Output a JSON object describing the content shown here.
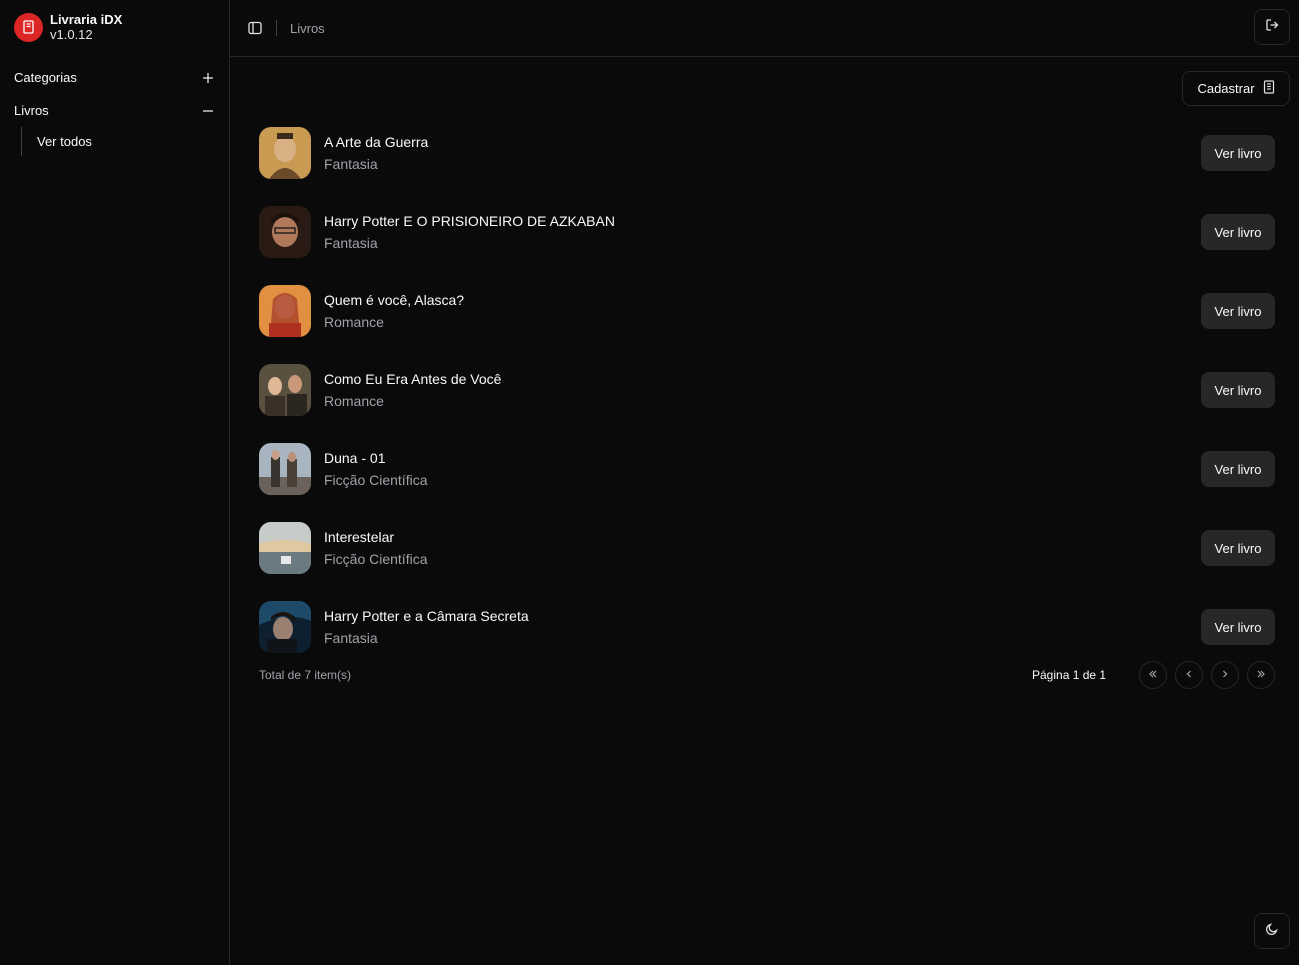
{
  "brand": {
    "name": "Livraria iDX",
    "version": "v1.0.12"
  },
  "sidebar": {
    "groups": [
      {
        "label": "Categorias",
        "state": "collapsed"
      },
      {
        "label": "Livros",
        "state": "expanded",
        "children": [
          {
            "label": "Ver todos"
          }
        ]
      }
    ]
  },
  "header": {
    "breadcrumb": "Livros"
  },
  "actions": {
    "cadastrar_label": "Cadastrar"
  },
  "books": [
    {
      "title": "A Arte da Guerra",
      "category": "Fantasia",
      "button": "Ver livro"
    },
    {
      "title": "Harry Potter E O PRISIONEIRO DE AZKABAN",
      "category": "Fantasia",
      "button": "Ver livro"
    },
    {
      "title": "Quem é você, Alasca?",
      "category": "Romance",
      "button": "Ver livro"
    },
    {
      "title": "Como Eu Era Antes de Você",
      "category": "Romance",
      "button": "Ver livro"
    },
    {
      "title": "Duna - 01",
      "category": "Ficção Científica",
      "button": "Ver livro"
    },
    {
      "title": "Interestelar",
      "category": "Ficção Científica",
      "button": "Ver livro"
    },
    {
      "title": "Harry Potter e a Câmara Secreta",
      "category": "Fantasia",
      "button": "Ver livro"
    }
  ],
  "pagination": {
    "total": "Total de 7 item(s)",
    "page": "Página 1 de 1"
  },
  "colors": {
    "brand": "#dc2626",
    "background": "#0a0a0a",
    "button": "#27272a",
    "muted": "#a1a1aa"
  }
}
